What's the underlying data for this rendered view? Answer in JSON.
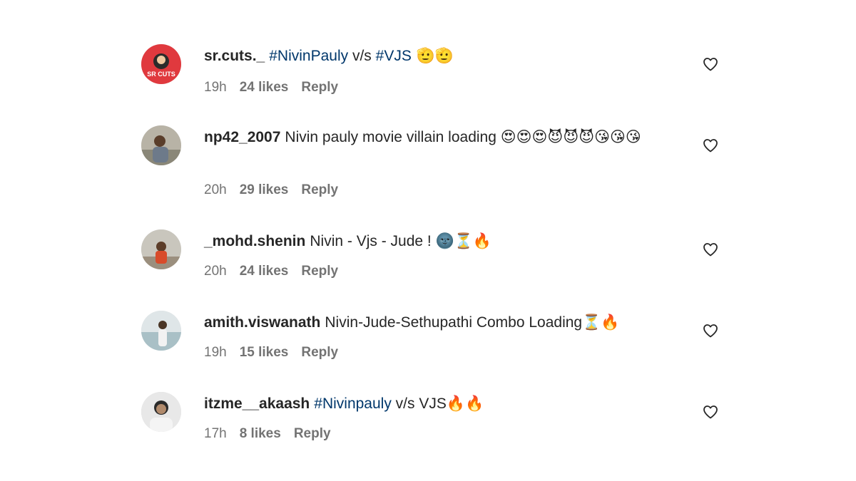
{
  "comments": [
    {
      "username": "sr.cuts._",
      "text_parts": [
        {
          "t": "tag",
          "v": "#NivinPauly"
        },
        {
          "t": "text",
          "v": " v/s "
        },
        {
          "t": "tag",
          "v": "#VJS"
        },
        {
          "t": "text",
          "v": " 🫡🫡"
        }
      ],
      "time": "19h",
      "likes": "24 likes",
      "reply": "Reply",
      "avatar_label": "SR CUTS"
    },
    {
      "username": "np42_2007",
      "text_parts": [
        {
          "t": "text",
          "v": "Nivin pauly movie villain loading "
        },
        {
          "t": "emoji",
          "v": "😍😍😍😈😈😈😘😘😘"
        }
      ],
      "time": "20h",
      "likes": "29 likes",
      "reply": "Reply"
    },
    {
      "username": "_mohd.shenin",
      "text_parts": [
        {
          "t": "text",
          "v": "Nivin - Vjs - Jude ! "
        },
        {
          "t": "emoji",
          "v": "🌚⏳🔥"
        }
      ],
      "time": "20h",
      "likes": "24 likes",
      "reply": "Reply"
    },
    {
      "username": "amith.viswanath",
      "text_parts": [
        {
          "t": "text",
          "v": "Nivin-Jude-Sethupathi Combo Loading"
        },
        {
          "t": "emoji",
          "v": "⏳🔥"
        }
      ],
      "time": "19h",
      "likes": "15 likes",
      "reply": "Reply"
    },
    {
      "username": "itzme__akaash",
      "text_parts": [
        {
          "t": "tag",
          "v": "#Nivinpauly"
        },
        {
          "t": "text",
          "v": " v/s VJS"
        },
        {
          "t": "emoji",
          "v": "🔥🔥"
        }
      ],
      "time": "17h",
      "likes": "8 likes",
      "reply": "Reply"
    }
  ],
  "colors": {
    "tag": "#00376b",
    "meta": "#737373",
    "text": "#262626",
    "avatar_srcuts": "#e0393e"
  },
  "icons": {
    "like": "heart-outline-icon"
  }
}
